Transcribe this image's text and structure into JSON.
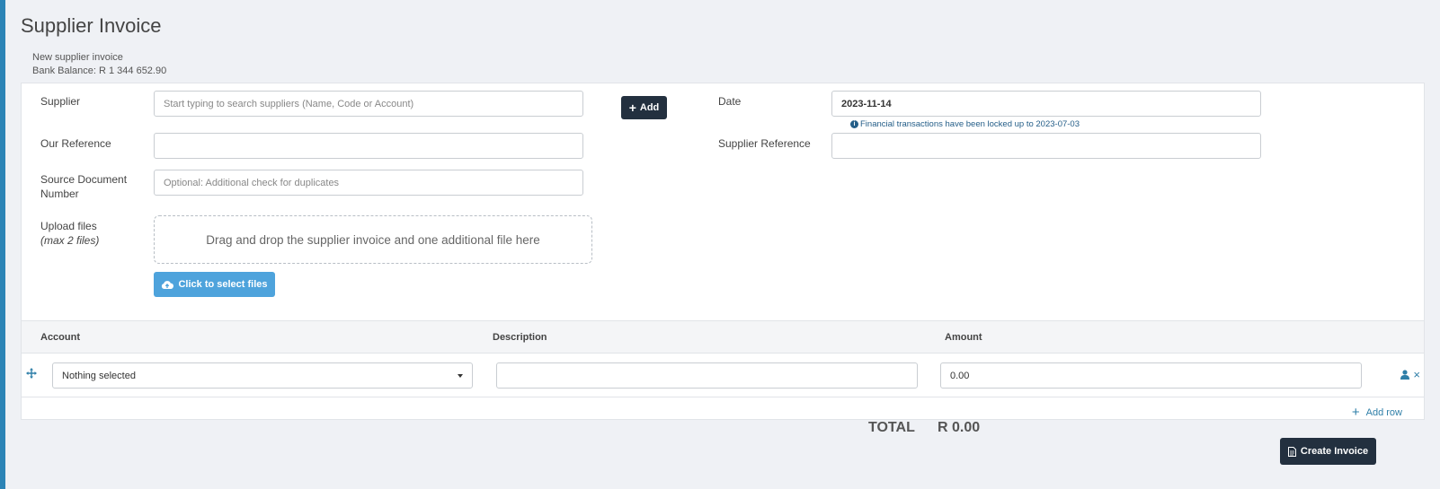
{
  "page": {
    "title": "Supplier Invoice",
    "subtitle": "New supplier invoice",
    "bank_balance": "Bank Balance: R 1 344 652.90"
  },
  "form": {
    "supplier_label": "Supplier",
    "supplier_placeholder": "Start typing to search suppliers (Name, Code or Account)",
    "add_label": "Add",
    "date_label": "Date",
    "date_value": "2023-11-14",
    "lock_note": "Financial transactions have been locked up to 2023-07-03",
    "our_reference_label": "Our Reference",
    "our_reference_value": "",
    "supplier_reference_label": "Supplier Reference",
    "supplier_reference_value": "",
    "source_doc_label_1": "Source Document",
    "source_doc_label_2": "Number",
    "source_doc_placeholder": "Optional: Additional check for duplicates",
    "upload_label": "Upload files",
    "upload_max": "(max 2 files)",
    "dropzone_text": "Drag and drop the supplier invoice and one additional file here",
    "select_files_label": "Click to select files"
  },
  "table": {
    "headers": [
      "Account",
      "Description",
      "Amount"
    ],
    "rows": [
      {
        "account": "Nothing selected",
        "description": "",
        "amount": "0.00"
      }
    ],
    "add_row_label": "Add row"
  },
  "totals": {
    "label": "TOTAL",
    "value": "R 0.00"
  },
  "actions": {
    "create_label": "Create Invoice"
  },
  "icons": {
    "plus": "plus-icon",
    "info": "info-icon",
    "cloud_upload": "cloud-upload-icon",
    "move": "move-icon",
    "user": "user-icon",
    "close": "close-icon",
    "document": "document-icon"
  },
  "colors": {
    "dark_button": "#23303f",
    "accent_blue": "#4ea3dc",
    "link_blue": "#2f7fa8",
    "left_bar": "#2c84b6"
  }
}
